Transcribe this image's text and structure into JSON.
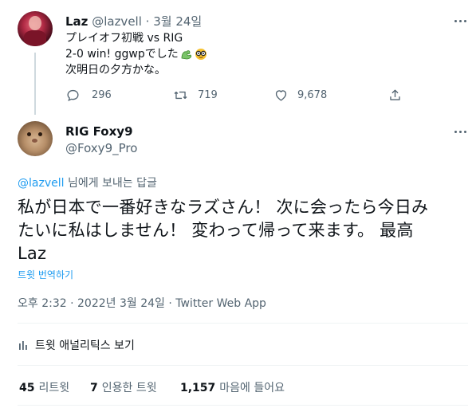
{
  "parent_tweet": {
    "display_name": "Laz",
    "handle": "@lazvell",
    "separator": "·",
    "date": "3월 24일",
    "lines": [
      "プレイオフ初戦 vs RIG",
      "2-0 win! ggwpでした",
      "次明日の夕方かな。"
    ],
    "emoji_icons": [
      "muscle-icon",
      "nerd-face-icon"
    ],
    "replies": "296",
    "retweets": "719",
    "likes": "9,678"
  },
  "main_tweet": {
    "display_name": "RIG Foxy9",
    "handle": "@Foxy9_Pro",
    "reply_to_handle": "@lazvell",
    "reply_to_suffix": "님에게 보내는 답글",
    "text_lines": [
      "私が日本で一番好きなラズさん！ 次に会ったら今日み",
      "たいに私はしません！ 変わって帰って来ます。 最高",
      "Laz"
    ],
    "translate_label": "트윗 번역하기",
    "timestamp": "오후 2:32 · 2022년 3월 24일 · Twitter Web App",
    "analytics_label": "트윗 애널리틱스 보기",
    "stats": {
      "retweets_count": "45",
      "retweets_label": "리트윗",
      "quotes_count": "7",
      "quotes_label": "인용한 트윗",
      "likes_count": "1,157",
      "likes_label": "마음에 들어요"
    }
  },
  "colors": {
    "accent": "#1d9bf0",
    "muted": "#536471",
    "text": "#0f1419",
    "divider": "#eff3f4"
  }
}
